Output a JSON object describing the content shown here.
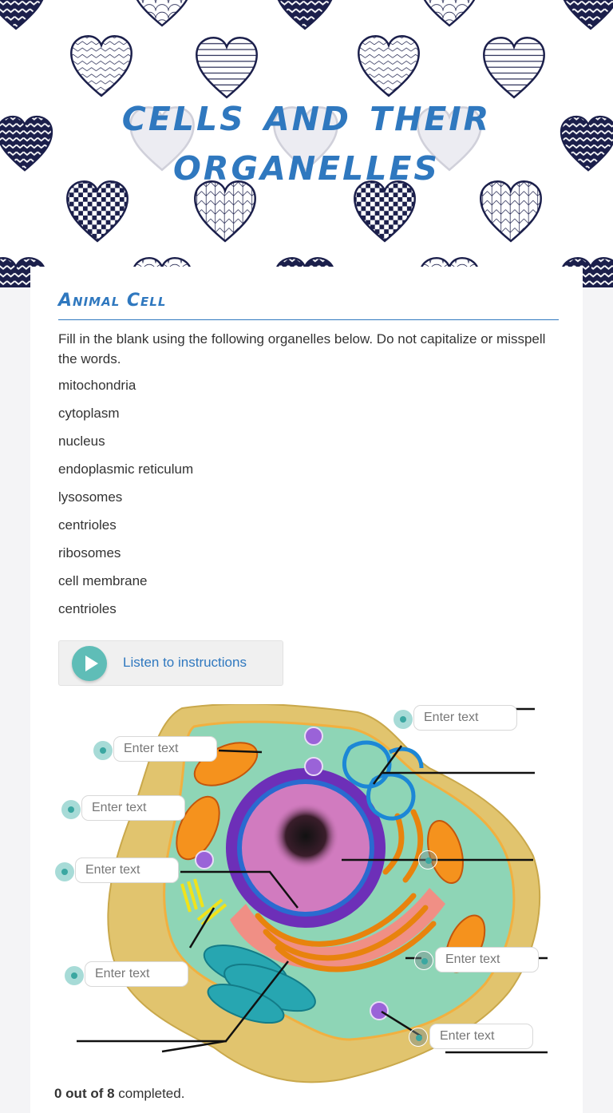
{
  "banner": {
    "title_line1": "Cells and their",
    "title_line2": "organelles",
    "pattern": "heart-pattern"
  },
  "section": {
    "title": "Animal Cell",
    "instructions": "Fill in the blank using the following organelles below. Do not capitalize or misspell the words.",
    "word_bank": [
      "mitochondria",
      "cytoplasm",
      "nucleus",
      "endoplasmic reticulum",
      "lysosomes",
      "centrioles",
      "ribosomes",
      "cell membrane",
      "centrioles"
    ]
  },
  "listen": {
    "label": "Listen to instructions",
    "icon": "play-icon"
  },
  "diagram": {
    "image": "animal-cell-illustration",
    "inputs": [
      {
        "placeholder": "Enter text",
        "value": ""
      },
      {
        "placeholder": "Enter text",
        "value": ""
      },
      {
        "placeholder": "Enter text",
        "value": ""
      },
      {
        "placeholder": "Enter text",
        "value": ""
      },
      {
        "placeholder": "Enter text",
        "value": ""
      },
      {
        "placeholder": "Enter text",
        "value": ""
      },
      {
        "placeholder": "Enter text",
        "value": ""
      },
      {
        "placeholder": "Enter text",
        "value": ""
      }
    ]
  },
  "progress": {
    "completed_bold": "0 out of 8",
    "completed_suffix": " completed.",
    "done": 0,
    "total": 8
  },
  "colors": {
    "accent": "#2f78bf",
    "teal": "#5fbdb7",
    "navy": "#1b1f4b"
  }
}
